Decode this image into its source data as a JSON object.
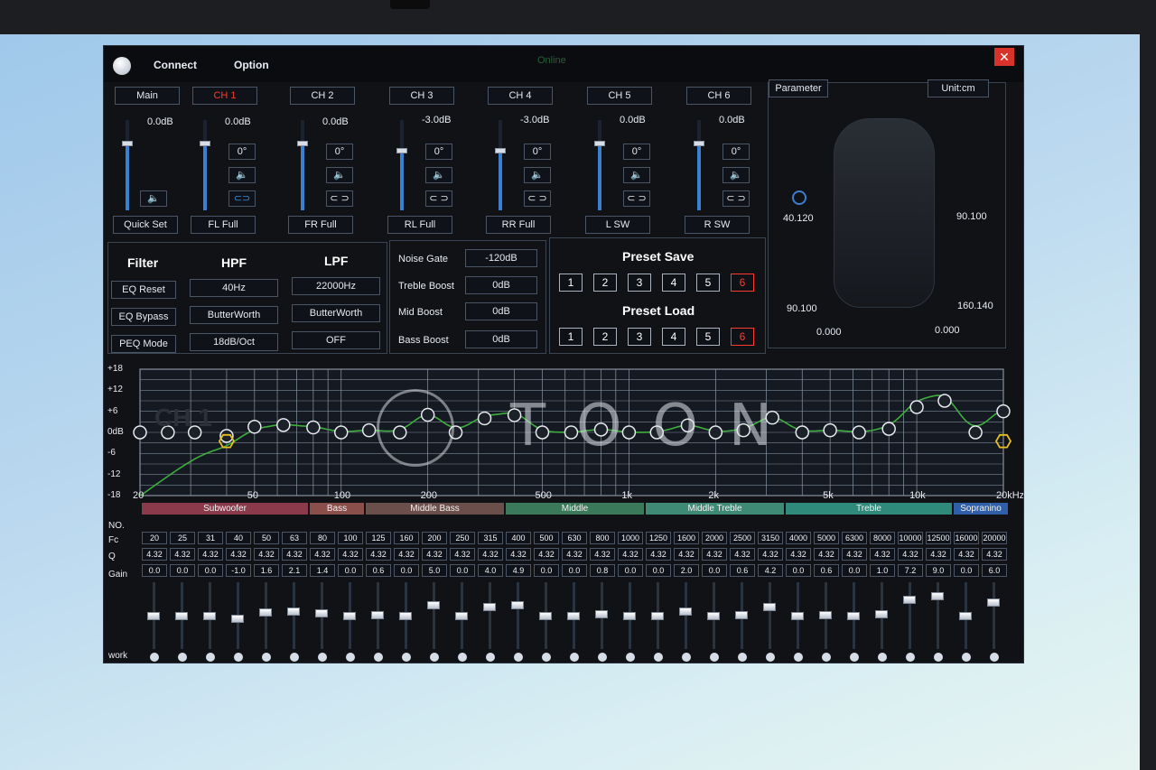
{
  "window": {
    "menu": [
      "Connect",
      "Option"
    ],
    "status": "Online"
  },
  "channels": [
    {
      "tab": "Main",
      "gain": "0.0dB",
      "bottom": "Quick Set",
      "active": false
    },
    {
      "tab": "CH 1",
      "gain": "0.0dB",
      "phase": "0°",
      "bottom": "FL Full",
      "active": true
    },
    {
      "tab": "CH 2",
      "gain": "0.0dB",
      "phase": "0°",
      "bottom": "FR Full",
      "active": false
    },
    {
      "tab": "CH 3",
      "gain": "-3.0dB",
      "phase": "0°",
      "bottom": "RL Full",
      "active": false
    },
    {
      "tab": "CH 4",
      "gain": "-3.0dB",
      "phase": "0°",
      "bottom": "RR Full",
      "active": false
    },
    {
      "tab": "CH 5",
      "gain": "0.0dB",
      "phase": "0°",
      "bottom": "L SW",
      "active": false
    },
    {
      "tab": "CH 6",
      "gain": "0.0dB",
      "phase": "0°",
      "bottom": "R SW",
      "active": false
    }
  ],
  "parameter": {
    "button": "Parameter",
    "unit": "Unit:cm",
    "values": [
      "40.120",
      "90.100",
      "90.100",
      "160.140",
      "0.000",
      "0.000"
    ]
  },
  "filter": {
    "title": "Filter",
    "hpf_title": "HPF",
    "lpf_title": "LPF",
    "buttons": [
      "EQ Reset",
      "EQ Bypass",
      "PEQ Mode"
    ],
    "hpf": [
      "40Hz",
      "ButterWorth",
      "18dB/Oct"
    ],
    "lpf": [
      "22000Hz",
      "ButterWorth",
      "OFF"
    ]
  },
  "boost": {
    "labels": [
      "Noise Gate",
      "Treble Boost",
      "Mid Boost",
      "Bass Boost"
    ],
    "values": [
      "-120dB",
      "0dB",
      "0dB",
      "0dB"
    ]
  },
  "presets": {
    "save_title": "Preset Save",
    "load_title": "Preset Load",
    "numbers": [
      "1",
      "2",
      "3",
      "4",
      "5",
      "6"
    ],
    "selected": "6"
  },
  "graph": {
    "channel_label": "CH 1",
    "watermark": "TOON",
    "y_ticks": [
      "+18",
      "+12",
      "+6",
      "0dB",
      "-6",
      "-12",
      "-18"
    ],
    "x_ticks": [
      "20",
      "50",
      "100",
      "200",
      "500",
      "1k",
      "2k",
      "5k",
      "10k",
      "20kHz"
    ],
    "curve_color": "#3fae3f",
    "node_color": "#e6e9ee",
    "hpf_node_color": "#e8c020"
  },
  "eq": {
    "row_labels": [
      "NO.",
      "Fc",
      "Q",
      "Gain",
      "work"
    ],
    "bands": [
      {
        "name": "Subwoofer",
        "color": "#8a3a4a"
      },
      {
        "name": "Bass",
        "color": "#8a4f4a"
      },
      {
        "name": "Middle Bass",
        "color": "#6a4f4a"
      },
      {
        "name": "Middle",
        "color": "#3a7a5a"
      },
      {
        "name": "Middle Treble",
        "color": "#3e8a74"
      },
      {
        "name": "Treble",
        "color": "#2f8a7c"
      },
      {
        "name": "Sopranino",
        "color": "#2e5fa8"
      }
    ],
    "fc": [
      "20",
      "25",
      "31",
      "40",
      "50",
      "63",
      "80",
      "100",
      "125",
      "160",
      "200",
      "250",
      "315",
      "400",
      "500",
      "630",
      "800",
      "1000",
      "1250",
      "1600",
      "2000",
      "2500",
      "3150",
      "4000",
      "5000",
      "6300",
      "8000",
      "10000",
      "12500",
      "16000",
      "20000"
    ],
    "q": [
      "4.32",
      "4.32",
      "4.32",
      "4.32",
      "4.32",
      "4.32",
      "4.32",
      "4.32",
      "4.32",
      "4.32",
      "4.32",
      "4.32",
      "4.32",
      "4.32",
      "4.32",
      "4.32",
      "4.32",
      "4.32",
      "4.32",
      "4.32",
      "4.32",
      "4.32",
      "4.32",
      "4.32",
      "4.32",
      "4.32",
      "4.32",
      "4.32",
      "4.32",
      "4.32",
      "4.32"
    ],
    "gain": [
      "0.0",
      "0.0",
      "0.0",
      "-1.0",
      "1.6",
      "2.1",
      "1.4",
      "0.0",
      "0.6",
      "0.0",
      "5.0",
      "0.0",
      "4.0",
      "4.9",
      "0.0",
      "0.0",
      "0.8",
      "0.0",
      "0.0",
      "2.0",
      "0.0",
      "0.6",
      "4.2",
      "0.0",
      "0.6",
      "0.0",
      "1.0",
      "7.2",
      "9.0",
      "0.0",
      "6.0"
    ]
  }
}
